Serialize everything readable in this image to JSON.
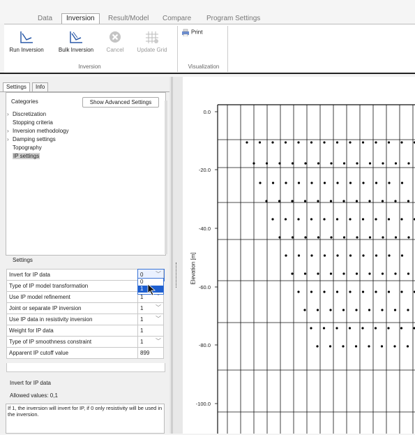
{
  "ribbon": {
    "tabs": [
      "Data",
      "Inversion",
      "Result/Model",
      "Compare",
      "Program Settings"
    ],
    "active_tab": "Inversion",
    "groups": {
      "inversion": {
        "label": "Inversion",
        "buttons": [
          {
            "label": "Run Inversion",
            "icon": "run-inversion-icon",
            "enabled": true
          },
          {
            "label": "Bulk Inversion",
            "icon": "bulk-inversion-icon",
            "enabled": true
          },
          {
            "label": "Cancel",
            "icon": "cancel-icon",
            "enabled": false
          },
          {
            "label": "Update Grid",
            "icon": "update-grid-icon",
            "enabled": false
          }
        ]
      },
      "visualization": {
        "label": "Visualization",
        "buttons": [
          {
            "label": "Print",
            "icon": "print-icon",
            "enabled": true
          }
        ]
      }
    }
  },
  "left_panel": {
    "tabs": [
      "Settings",
      "Info"
    ],
    "categories_label": "Categories",
    "advanced_button": "Show Advanced Settings",
    "tree": [
      {
        "label": "Discretization",
        "expandable": true
      },
      {
        "label": "Stopping criteria",
        "expandable": false
      },
      {
        "label": "Inversion methodology",
        "expandable": true
      },
      {
        "label": "Damping settings",
        "expandable": true
      },
      {
        "label": "Topography",
        "expandable": false
      },
      {
        "label": "IP settings",
        "expandable": false,
        "selected": true
      }
    ],
    "settings_label": "Settings",
    "settings_rows": [
      {
        "name": "Invert for IP data",
        "value": "0",
        "dropdown": true
      },
      {
        "name": "Type of IP model transformation",
        "value": "",
        "dropdown": false
      },
      {
        "name": "Use IP model refinement",
        "value": "1",
        "dropdown": true
      },
      {
        "name": "Joint or separate IP inversion",
        "value": "1",
        "dropdown": true
      },
      {
        "name": "Use IP data in resistivity inversion",
        "value": "1",
        "dropdown": true
      },
      {
        "name": "Weight for IP data",
        "value": "1",
        "dropdown": false
      },
      {
        "name": "Type of IP smoothness constraint",
        "value": "1",
        "dropdown": true
      },
      {
        "name": "Apparent IP cutoff value",
        "value": "899",
        "dropdown": false
      }
    ],
    "dropdown_options": [
      "0",
      "1"
    ],
    "description": {
      "title": "Invert for IP data",
      "allowed": "Allowed values: 0,1",
      "text": "If 1, the inversion will invert for IP, if 0 only resistivity will be used in the inversion."
    }
  },
  "plot": {
    "ylabel": "Elevation [m]",
    "y_ticks": [
      "0.0",
      "-20.0",
      "-40.0",
      "-60.0",
      "-80.0",
      "-100.0"
    ]
  },
  "colors": {
    "selection": "#1e5fcf",
    "accent": "#3b74d6"
  }
}
